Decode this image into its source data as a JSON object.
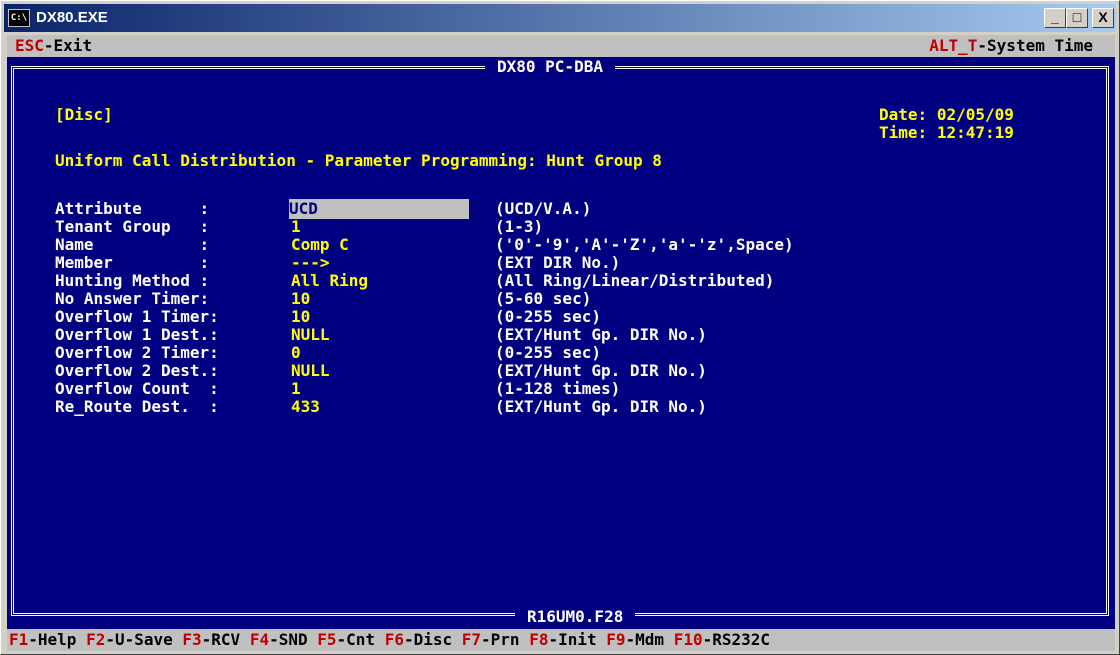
{
  "window": {
    "title": "DX80.EXE",
    "icon_label": "C:\\",
    "min_label": "_",
    "max_label": "□",
    "close_label": "X"
  },
  "topbar": {
    "esc_key": "ESC",
    "esc_text": "-Exit",
    "alt_key": "ALT_T",
    "alt_text": "-System Time"
  },
  "frame": {
    "title": "DX80 PC-DBA",
    "footer": "R16UM0.F28"
  },
  "header": {
    "section": "[Disc]",
    "date_label": "Date:",
    "date": "02/05/09",
    "time_label": "Time:",
    "time": "12:47:19",
    "heading": "Uniform Call Distribution - Parameter Programming: Hunt Group 8"
  },
  "params": [
    {
      "label": "Attribute      :",
      "value": "UCD",
      "hint": "(UCD/V.A.)"
    },
    {
      "label": "Tenant Group   :",
      "value": "1",
      "hint": "(1-3)"
    },
    {
      "label": "Name           :",
      "value": "Comp C",
      "hint": "('0'-'9','A'-'Z','a'-'z',Space)"
    },
    {
      "label": "Member         :",
      "value": "--->",
      "hint": "(EXT DIR No.)"
    },
    {
      "label": "Hunting Method :",
      "value": "All Ring",
      "hint": "(All Ring/Linear/Distributed)"
    },
    {
      "label": "No Answer Timer:",
      "value": "10",
      "hint": "(5-60 sec)"
    },
    {
      "label": "Overflow 1 Timer:",
      "value": "10",
      "hint": "(0-255 sec)"
    },
    {
      "label": "Overflow 1 Dest.:",
      "value": "NULL",
      "hint": "(EXT/Hunt Gp. DIR No.)"
    },
    {
      "label": "Overflow 2 Timer:",
      "value": "0",
      "hint": "(0-255 sec)"
    },
    {
      "label": "Overflow 2 Dest.:",
      "value": "NULL",
      "hint": "(EXT/Hunt Gp. DIR No.)"
    },
    {
      "label": "Overflow Count  :",
      "value": "1",
      "hint": "(1-128 times)"
    },
    {
      "label": "Re_Route Dest.  :",
      "value": "433",
      "hint": "(EXT/Hunt Gp. DIR No.)"
    }
  ],
  "fkeys": [
    {
      "key": "F1",
      "text": "-Help "
    },
    {
      "key": "F2",
      "text": "-U-Save "
    },
    {
      "key": "F3",
      "text": "-RCV "
    },
    {
      "key": "F4",
      "text": "-SND "
    },
    {
      "key": "F5",
      "text": "-Cnt  "
    },
    {
      "key": "F6",
      "text": "-Disc "
    },
    {
      "key": "F7",
      "text": "-Prn "
    },
    {
      "key": "F8",
      "text": "-Init "
    },
    {
      "key": "F9",
      "text": "-Mdm "
    },
    {
      "key": "F10",
      "text": "-RS232C"
    }
  ],
  "colors": {
    "console_bg": "#000080",
    "text_white": "#ffffff",
    "text_yellow": "#ffff00",
    "key_red": "#c00000",
    "bar_gray": "#c0c0c0"
  }
}
